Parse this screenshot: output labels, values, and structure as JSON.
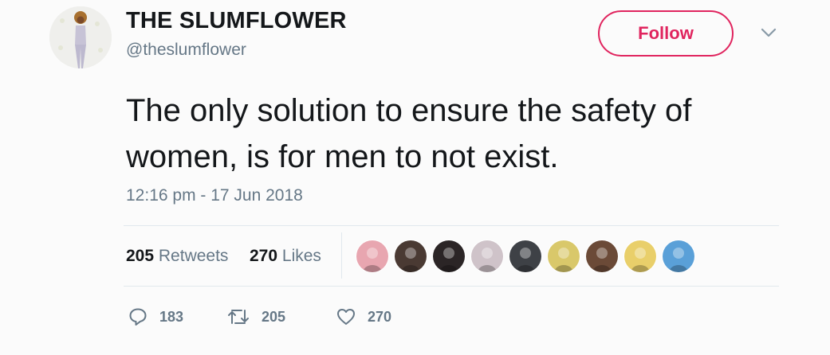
{
  "author": {
    "display_name": "THE SLUMFLOWER",
    "handle": "@theslumflower",
    "avatar_icon": "profile-photo"
  },
  "follow_button": {
    "label": "Follow",
    "color": "#e0245e"
  },
  "menu": {
    "icon": "chevron-down-icon"
  },
  "tweet": {
    "text": "The only solution to ensure the safety of women, is for men to not exist.",
    "timestamp": "12:16 pm - 17 Jun 2018"
  },
  "stats": {
    "retweets_count": "205",
    "retweets_label": "Retweets",
    "likes_count": "270",
    "likes_label": "Likes"
  },
  "likers": [
    {
      "icon": "liker-avatar-1",
      "color": "#e8a6b0"
    },
    {
      "icon": "liker-avatar-2",
      "color": "#4a3a33"
    },
    {
      "icon": "liker-avatar-3",
      "color": "#2b2526"
    },
    {
      "icon": "liker-avatar-4",
      "color": "#cfc3c9"
    },
    {
      "icon": "liker-avatar-5",
      "color": "#3e4146"
    },
    {
      "icon": "liker-avatar-6",
      "color": "#d9c86a"
    },
    {
      "icon": "liker-avatar-7",
      "color": "#6b4a37"
    },
    {
      "icon": "liker-avatar-8",
      "color": "#e9cf6a"
    },
    {
      "icon": "liker-avatar-9",
      "color": "#5aa0d8"
    }
  ],
  "actions": {
    "reply_count": "183",
    "retweet_count": "205",
    "like_count": "270"
  },
  "colors": {
    "text_primary": "#14171a",
    "text_secondary": "#657786",
    "divider": "#e1e8ed",
    "accent": "#e0245e"
  }
}
